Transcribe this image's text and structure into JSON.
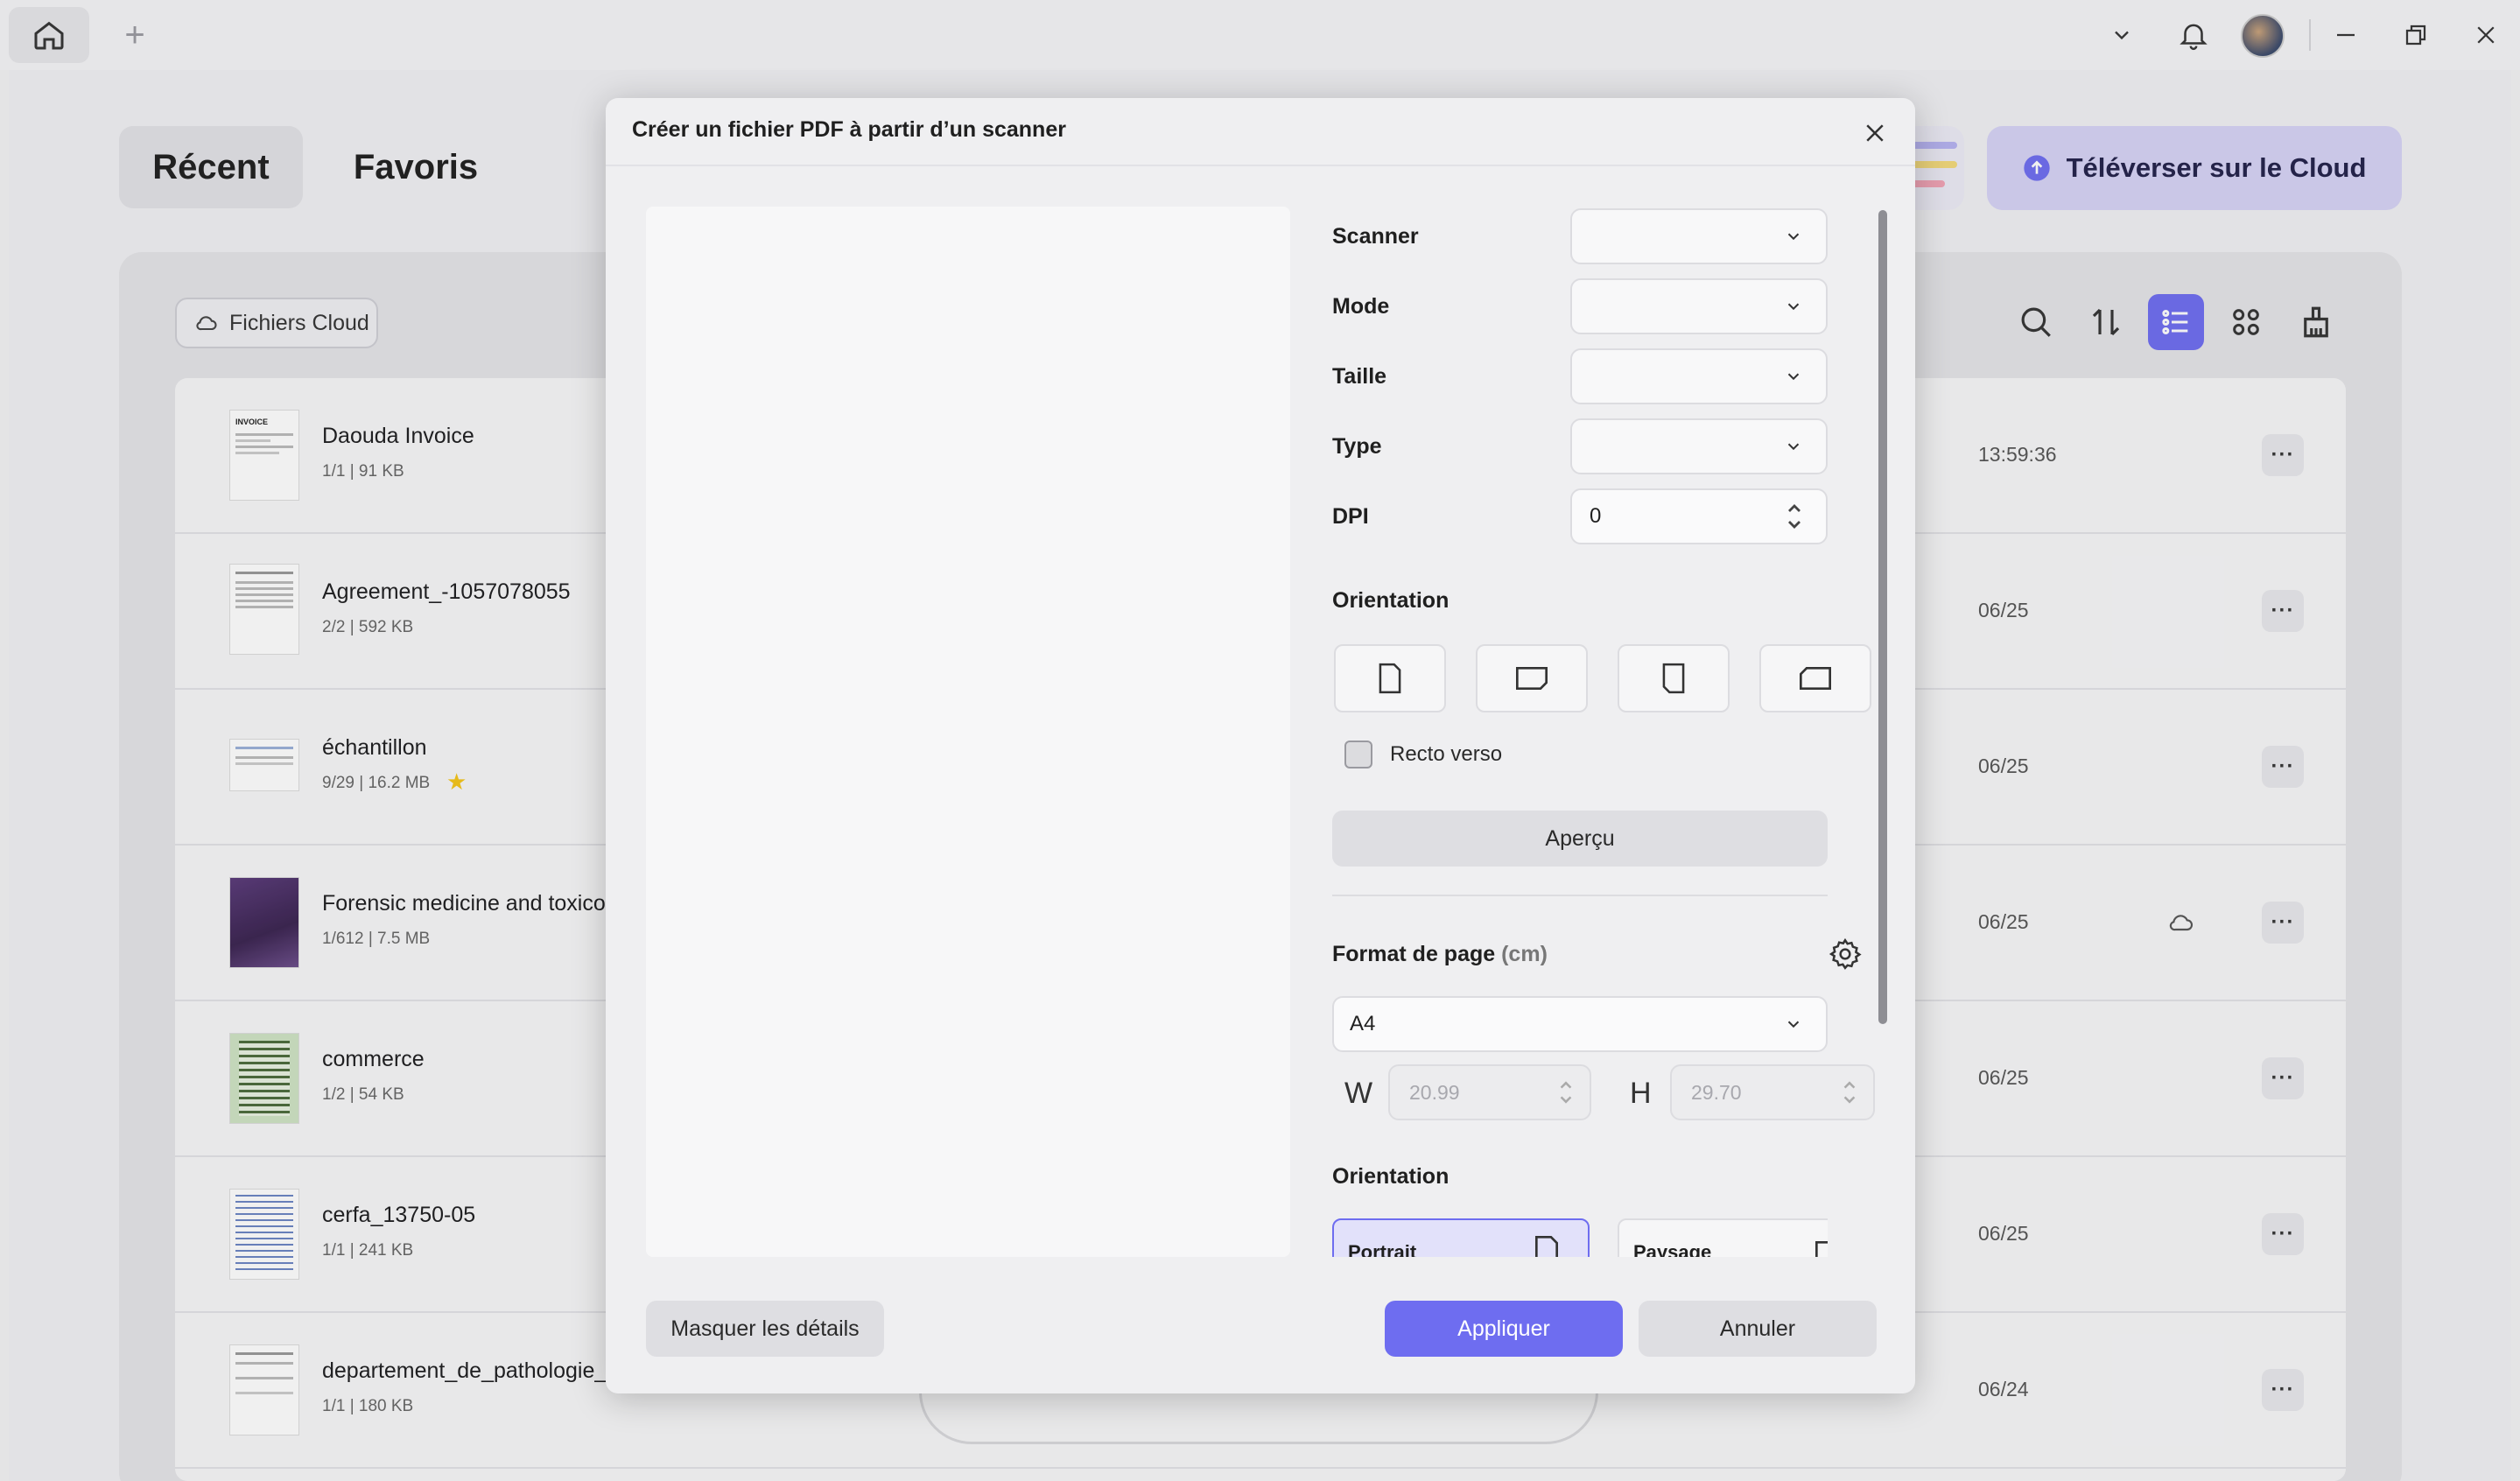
{
  "tabs": {
    "recent": "Récent",
    "favorites": "Favoris"
  },
  "cloud_chip": "Fichiers Cloud",
  "upload_label": "Téléverser sur le Cloud",
  "files": [
    {
      "name": "Daouda Invoice",
      "meta": "1/1 | 91 KB",
      "date": "13:59:36",
      "starred": false,
      "cloud": false
    },
    {
      "name": "Agreement_-1057078055",
      "meta": "2/2 | 592 KB",
      "date": "06/25",
      "starred": false,
      "cloud": false
    },
    {
      "name": "échantillon",
      "meta": "9/29 | 16.2 MB",
      "date": "06/25",
      "starred": true,
      "cloud": false
    },
    {
      "name": "Forensic medicine and toxicolo",
      "meta": "1/612 | 7.5 MB",
      "date": "06/25",
      "starred": false,
      "cloud": true
    },
    {
      "name": "commerce",
      "meta": "1/2 | 54 KB",
      "date": "06/25",
      "starred": false,
      "cloud": false
    },
    {
      "name": "cerfa_13750-05",
      "meta": "1/1 | 241 KB",
      "date": "06/25",
      "starred": false,
      "cloud": false
    },
    {
      "name": "departement_de_pathologie_de",
      "meta": "1/1 | 180 KB",
      "date": "06/24",
      "starred": false,
      "cloud": false
    }
  ],
  "more_label": "···",
  "modal": {
    "title": "Créer un fichier PDF à partir d’un scanner",
    "fields": {
      "scanner": "Scanner",
      "mode": "Mode",
      "taille": "Taille",
      "type": "Type",
      "dpi": "DPI"
    },
    "dpi_value": "0",
    "orientation_label": "Orientation",
    "duplex_label": "Recto verso",
    "duplex_checked": false,
    "preview_button": "Aperçu",
    "page_format_label": "Format de page",
    "page_format_unit": "(cm)",
    "page_size": "A4",
    "width_label": "W",
    "width_value": "20.99",
    "height_label": "H",
    "height_value": "29.70",
    "orientation2_label": "Orientation",
    "portrait_label": "Portrait",
    "landscape_label": "Paysage",
    "hide_details": "Masquer les détails",
    "apply": "Appliquer",
    "cancel": "Annuler"
  },
  "colors": {
    "accent": "#6e6df0",
    "accent_light": "#d6d3f6",
    "star": "#f5c518"
  }
}
